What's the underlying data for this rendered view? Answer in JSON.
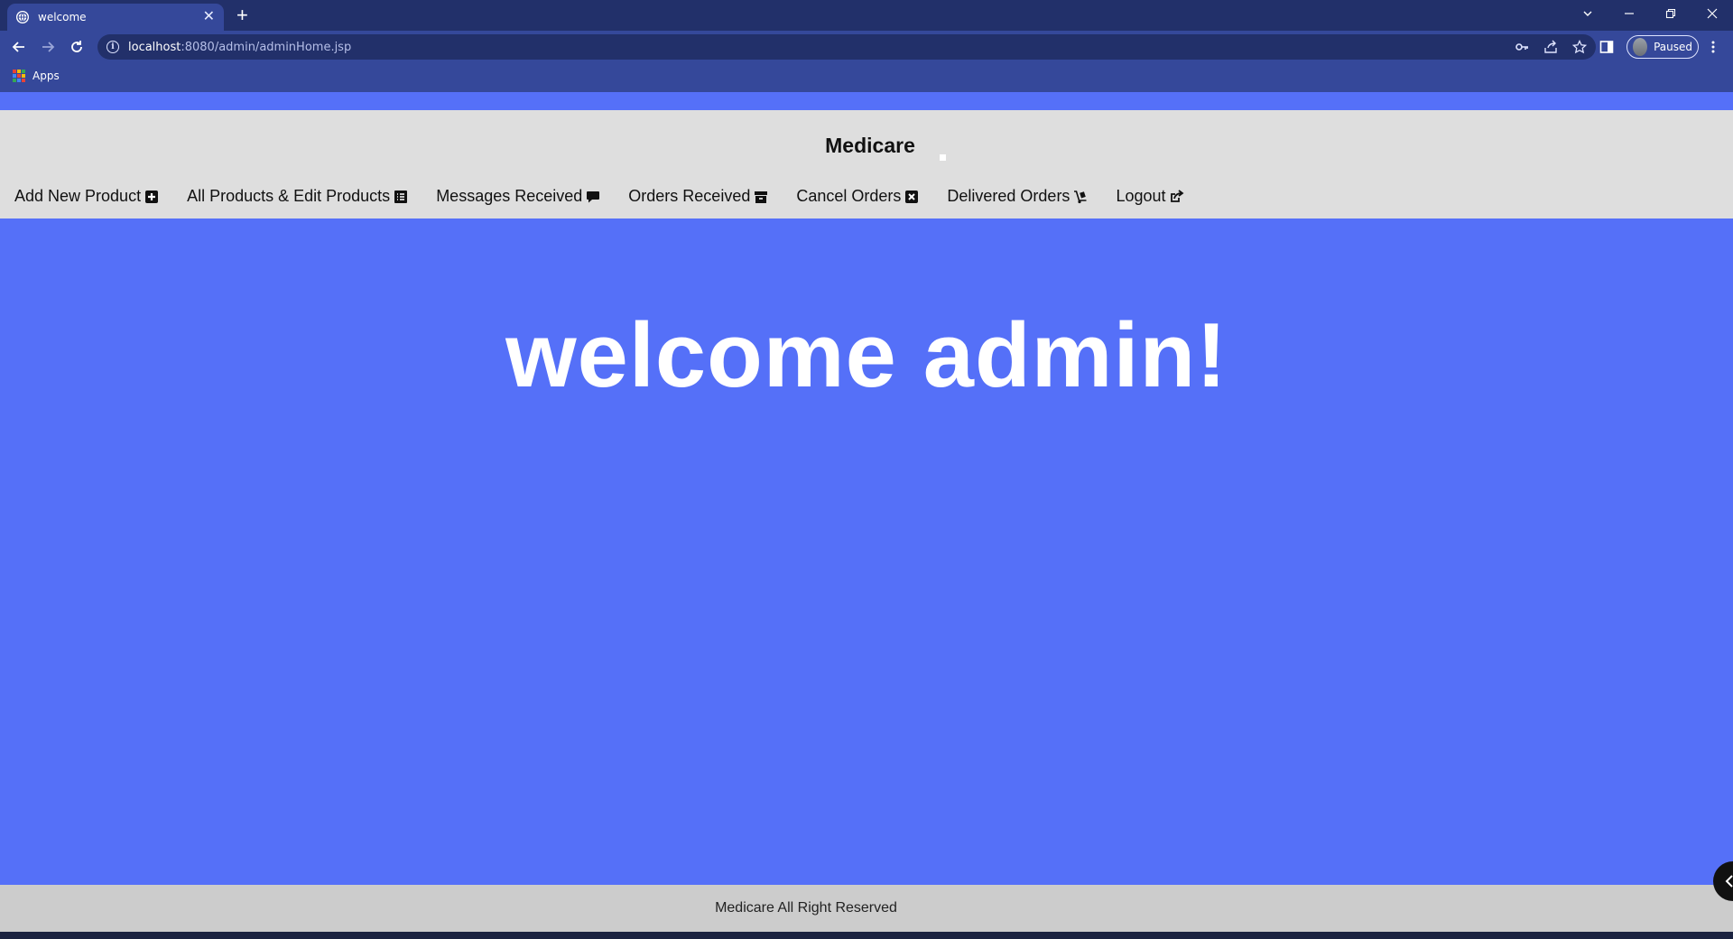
{
  "browser": {
    "tab": {
      "title": "welcome",
      "favicon": "globe-icon"
    },
    "new_tab": "+",
    "window_paused": "Paused",
    "address": {
      "host": "localhost",
      "path": ":8080/admin/adminHome.jsp"
    },
    "bookmarks": [
      {
        "label": "Apps",
        "icon": "apps-grid-icon"
      }
    ]
  },
  "site": {
    "brand": "Medicare",
    "nav": [
      {
        "label": "Add New Product",
        "icon": "plus-square-icon"
      },
      {
        "label": "All Products & Edit Products",
        "icon": "list-square-icon"
      },
      {
        "label": "Messages Received",
        "icon": "comment-icon"
      },
      {
        "label": "Orders Received",
        "icon": "archive-box-icon"
      },
      {
        "label": "Cancel Orders",
        "icon": "x-square-icon"
      },
      {
        "label": "Delivered Orders",
        "icon": "dolly-icon"
      },
      {
        "label": "Logout",
        "icon": "share-square-icon"
      }
    ],
    "hero": "welcome admin!",
    "footer": "Medicare All Right Reserved"
  },
  "colors": {
    "page_bg": "#5570f8",
    "header_bg": "#dedede",
    "footer_bg": "#cccccc",
    "browser_dark": "#22306a",
    "browser_light": "#35489a"
  }
}
